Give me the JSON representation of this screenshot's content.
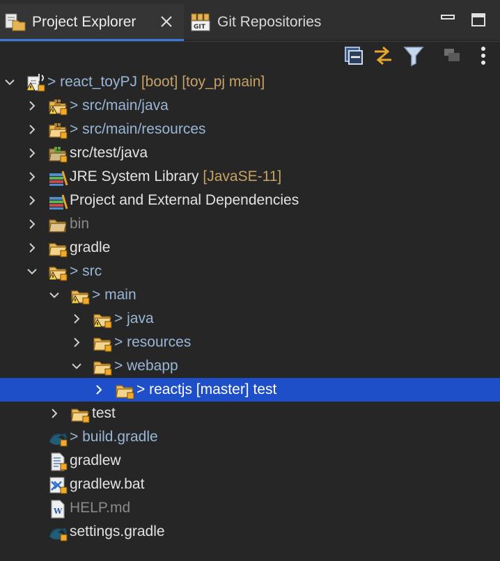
{
  "tabs": [
    {
      "label": "Project Explorer",
      "active": true,
      "icon": "project-explorer-icon"
    },
    {
      "label": "Git Repositories",
      "active": false,
      "icon": "git-repositories-icon"
    }
  ],
  "toolbar": [
    {
      "name": "collapse-all-icon"
    },
    {
      "name": "link-with-editor-icon"
    },
    {
      "name": "filter-icon"
    },
    {
      "name": "select-working-set-icon"
    },
    {
      "name": "view-menu-icon"
    }
  ],
  "tree": {
    "rows": [
      {
        "prefix": "> ",
        "text": "react_toyPJ",
        "suffix": " [boot] [toy_pj main]",
        "chevron": "down"
      },
      {
        "prefix": "> ",
        "text": "src/main/java",
        "suffix": "",
        "chevron": "right"
      },
      {
        "prefix": "> ",
        "text": "src/main/resources",
        "suffix": "",
        "chevron": "right"
      },
      {
        "prefix": "",
        "text": "src/test/java",
        "suffix": "",
        "chevron": "right"
      },
      {
        "prefix": "",
        "text": "JRE System Library",
        "suffix": " [JavaSE-11]",
        "chevron": "right"
      },
      {
        "prefix": "",
        "text": "Project and External Dependencies",
        "suffix": "",
        "chevron": "right"
      },
      {
        "prefix": "",
        "text": "bin",
        "suffix": "",
        "chevron": "right"
      },
      {
        "prefix": "",
        "text": "gradle",
        "suffix": "",
        "chevron": "right"
      },
      {
        "prefix": "> ",
        "text": "src",
        "suffix": "",
        "chevron": "down"
      },
      {
        "prefix": "> ",
        "text": "main",
        "suffix": "",
        "chevron": "down"
      },
      {
        "prefix": "> ",
        "text": "java",
        "suffix": "",
        "chevron": "right"
      },
      {
        "prefix": "> ",
        "text": "resources",
        "suffix": "",
        "chevron": "right"
      },
      {
        "prefix": "> ",
        "text": "webapp",
        "suffix": "",
        "chevron": "down"
      },
      {
        "prefix": "> ",
        "text": "reactjs [master] test",
        "suffix": "",
        "chevron": "right"
      },
      {
        "prefix": "",
        "text": "test",
        "suffix": "",
        "chevron": "right"
      },
      {
        "prefix": "> ",
        "text": "build.gradle",
        "suffix": "",
        "chevron": "none"
      },
      {
        "prefix": "",
        "text": "gradlew",
        "suffix": "",
        "chevron": "none"
      },
      {
        "prefix": "",
        "text": "gradlew.bat",
        "suffix": "",
        "chevron": "none"
      },
      {
        "prefix": "",
        "text": "HELP.md",
        "suffix": "",
        "chevron": "none"
      },
      {
        "prefix": "",
        "text": "settings.gradle",
        "suffix": "",
        "chevron": "none"
      }
    ]
  },
  "colors": {
    "background": "#262626",
    "selection": "#1e4fc8",
    "tab_underline": "#3a7ad9",
    "decoration": "#c7a265",
    "dirty_text": "#9ab6d6",
    "ignored_text": "#8a8a8a"
  }
}
